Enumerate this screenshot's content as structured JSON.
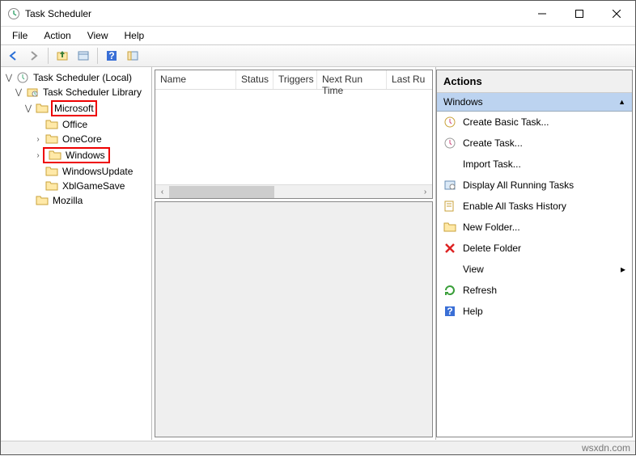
{
  "window": {
    "title": "Task Scheduler"
  },
  "menu": {
    "file": "File",
    "action": "Action",
    "view": "View",
    "help": "Help"
  },
  "tree": {
    "root": "Task Scheduler (Local)",
    "library": "Task Scheduler Library",
    "microsoft": "Microsoft",
    "office": "Office",
    "onecore": "OneCore",
    "windows": "Windows",
    "windowsupdate": "WindowsUpdate",
    "xblgamesave": "XblGameSave",
    "mozilla": "Mozilla"
  },
  "columns": {
    "name": "Name",
    "status": "Status",
    "triggers": "Triggers",
    "next": "Next Run Time",
    "last": "Last Ru"
  },
  "actions": {
    "title": "Actions",
    "context": "Windows",
    "create_basic": "Create Basic Task...",
    "create_task": "Create Task...",
    "import_task": "Import Task...",
    "display_all": "Display All Running Tasks",
    "enable_history": "Enable All Tasks History",
    "new_folder": "New Folder...",
    "delete_folder": "Delete Folder",
    "view": "View",
    "refresh": "Refresh",
    "help": "Help"
  },
  "footer": "wsxdn.com"
}
